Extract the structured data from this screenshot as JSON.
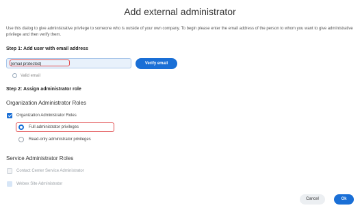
{
  "dialog": {
    "title": "Add external administrator",
    "intro": "Use this dialog to give administrative privilege to someone who is outside of your own company. To begin please enter the email address of the person to whom you want to give administrative privilege and then verify them."
  },
  "step1": {
    "heading": "Step 1: Add user with email address",
    "email_value": "[email protected]",
    "verify_label": "Verify email",
    "valid_label": "Valid email"
  },
  "step2": {
    "heading": "Step 2: Assign administrator role",
    "org_section": "Organization Administrator Roles",
    "org_checkbox_label": "Organization Administrator Roles",
    "options": [
      {
        "label": "Full administrator privileges",
        "selected": true
      },
      {
        "label": "Read-only administrator privileges",
        "selected": false
      }
    ],
    "service_section": "Service Administrator Roles",
    "service_roles": [
      {
        "label": "Contact Center Service Administrator"
      },
      {
        "label": "Webex Site Administrator"
      }
    ]
  },
  "footer": {
    "cancel_label": "Cancel",
    "ok_label": "Ok"
  },
  "colors": {
    "accent": "#1a6fd6",
    "highlight": "#e0484a"
  }
}
